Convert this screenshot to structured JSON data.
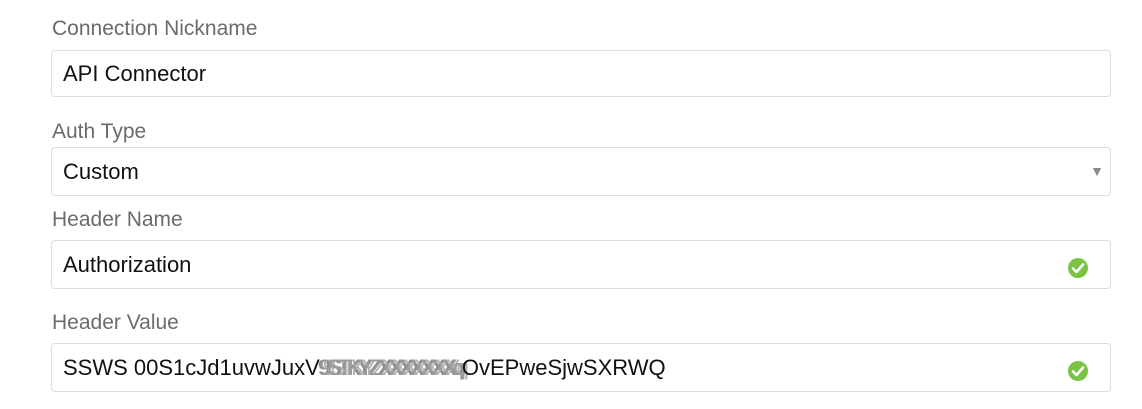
{
  "form": {
    "nickname": {
      "label": "Connection Nickname",
      "value": "API Connector"
    },
    "auth_type": {
      "label": "Auth Type",
      "selected": "Custom",
      "caret": "▼"
    },
    "header_name": {
      "label": "Header Name",
      "value": "Authorization",
      "status_icon": "valid-check-icon",
      "status_color": "#7cc243"
    },
    "header_value": {
      "label": "Header Value",
      "value_prefix": "SSWS 00S1cJd1uvwJuxV",
      "value_redacted": "9STKYZXXXXXXXq",
      "value_suffix": "OvEPweSjwSXRWQ",
      "status_icon": "valid-check-icon",
      "status_color": "#7cc243"
    }
  }
}
